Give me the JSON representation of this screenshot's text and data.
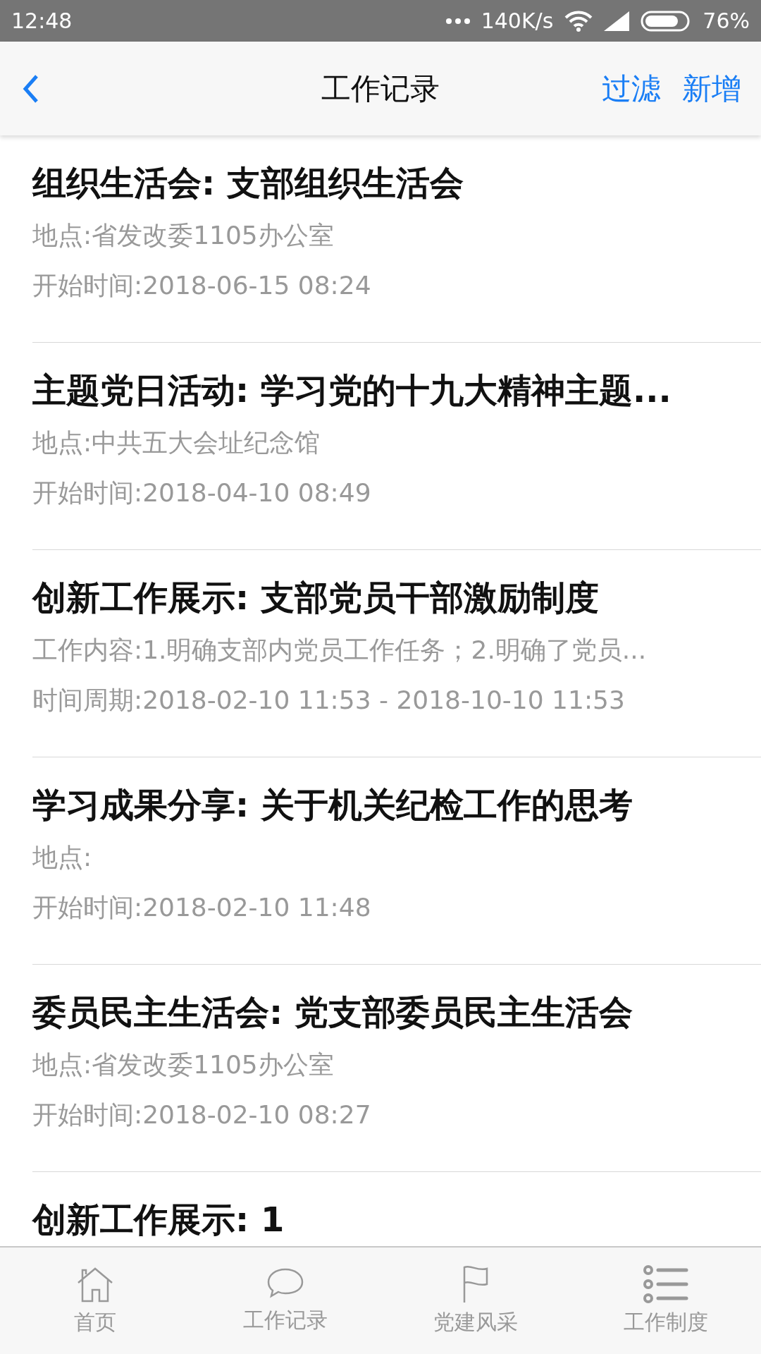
{
  "status_bar": {
    "time": "12:48",
    "speed": "140K/s",
    "battery": "76%"
  },
  "nav_bar": {
    "title": "工作记录",
    "actions": [
      "过滤",
      "新增"
    ]
  },
  "records": [
    {
      "title": "组织生活会: 支部组织生活会",
      "details": [
        "地点:省发改委1105办公室",
        "开始时间:2018-06-15 08:24"
      ]
    },
    {
      "title": "主题党日活动: 学习党的十九大精神主题...",
      "details": [
        "地点:中共五大会址纪念馆",
        "开始时间:2018-04-10 08:49"
      ]
    },
    {
      "title": "创新工作展示: 支部党员干部激励制度",
      "details": [
        "工作内容:1.明确支部内党员工作任务；2.明确了党员...",
        "时间周期:2018-02-10 11:53 - 2018-10-10 11:53"
      ]
    },
    {
      "title": "学习成果分享: 关于机关纪检工作的思考",
      "details": [
        "地点:",
        "开始时间:2018-02-10 11:48"
      ]
    },
    {
      "title": "委员民主生活会: 党支部委员民主生活会",
      "details": [
        "地点:省发改委1105办公室",
        "开始时间:2018-02-10 08:27"
      ]
    },
    {
      "title": "创新工作展示: 1"
    }
  ],
  "tabs": [
    {
      "label": "首页",
      "kind": "home",
      "selected": false
    },
    {
      "label": "工作记录",
      "kind": "chat",
      "selected": false
    },
    {
      "label": "党建风采",
      "kind": "flag",
      "selected": false
    },
    {
      "label": "工作制度",
      "kind": "list",
      "selected": false
    }
  ]
}
